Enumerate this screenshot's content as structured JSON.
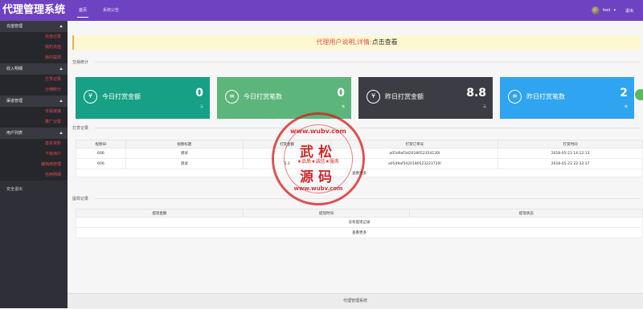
{
  "app": {
    "brand": "代理管理系统"
  },
  "topnav": {
    "tabs": [
      {
        "label": "首页"
      },
      {
        "label": "系统公告"
      }
    ]
  },
  "user": {
    "name": "test",
    "logout": "退出"
  },
  "sidebar": {
    "groups": [
      {
        "label": "充值管理",
        "items": [
          "充值记录",
          "我的充值",
          "我的提现"
        ]
      },
      {
        "label": "收入明细",
        "items": [
          "打赏记录",
          "分佣统计"
        ]
      },
      {
        "label": "渠道管理",
        "items": [
          "专属链接",
          "推广记录"
        ]
      },
      {
        "label": "用户列表",
        "items": [
          "基本资料",
          "下级用户",
          "编辑用管理",
          "信用明细"
        ]
      }
    ],
    "plain": "安全退出"
  },
  "notice": {
    "text": "代理用户说明,详情:",
    "link": "点击查看"
  },
  "sections": {
    "stats": "交易统计",
    "payments": "打赏记录",
    "withdraw": "提现记录"
  },
  "cards": [
    {
      "icon": "¥",
      "label": "今日打赏金额",
      "value": "0",
      "unit": "元",
      "color": "#16a085"
    },
    {
      "icon": "≡",
      "label": "今日打赏笔数",
      "value": "0",
      "unit": "笔",
      "color": "#5cb57a"
    },
    {
      "icon": "¥",
      "label": "昨日打赏金额",
      "value": "8.8",
      "unit": "元",
      "color": "#3c3c44"
    },
    {
      "icon": "≡",
      "label": "昨日打赏笔数",
      "value": "2",
      "unit": "笔",
      "color": "#2fa4f0"
    }
  ],
  "payments_table": {
    "headers": [
      "视频ID",
      "视频标题",
      "打赏金额",
      "打赏订单号",
      "打赏时间"
    ],
    "rows": [
      [
        "606",
        "测试",
        "",
        "a05d9af3d2018052354120I",
        "2018-05-23 14:12:13"
      ],
      [
        "606",
        "测试",
        "5.3",
        "a05d9af3d20180523223720I",
        "2018-05-23 22:33:37"
      ]
    ],
    "more": "查看更多"
  },
  "withdraw_table": {
    "headers": [
      "提现金额",
      "提现时间",
      "提现状态"
    ],
    "empty": "没有提现记录",
    "more": "查看更多"
  },
  "footer": {
    "text": "代理管理系统"
  },
  "stamp": {
    "top": "www.wubv.com",
    "main1": "武松",
    "mid": "★品质★诚信★服务",
    "main2": "源码",
    "bottom": "www.wubv.com"
  }
}
